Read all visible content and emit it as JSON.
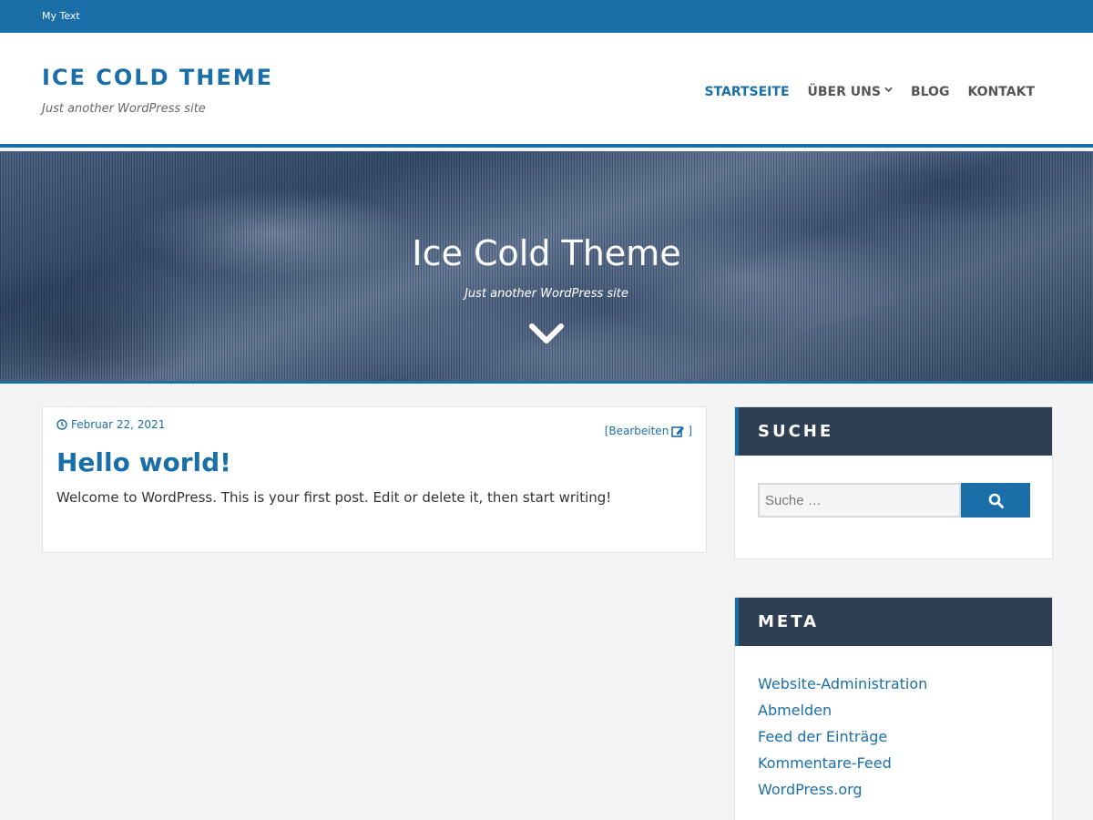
{
  "topbar": {
    "text": "My Text"
  },
  "header": {
    "site_title": "ICE COLD THEME",
    "tagline": "Just another WordPress site"
  },
  "nav": {
    "items": [
      {
        "label": "STARTSEITE",
        "active": true
      },
      {
        "label": "ÜBER UNS",
        "has_dropdown": true
      },
      {
        "label": "BLOG"
      },
      {
        "label": "KONTAKT"
      }
    ]
  },
  "hero": {
    "title": "Ice Cold Theme",
    "tagline": "Just another WordPress site",
    "arrow_icon": "chevron-down-icon"
  },
  "post": {
    "date": "Februar 22, 2021",
    "edit_label": "[Bearbeiten",
    "edit_close": "]",
    "title": "Hello world!",
    "excerpt": "Welcome to WordPress. This is your first post. Edit or delete it, then start writing!"
  },
  "sidebar": {
    "search": {
      "title": "SUCHE",
      "placeholder": "Suche …",
      "button_icon": "search-icon"
    },
    "meta": {
      "title": "META",
      "links": [
        "Website-Administration",
        "Abmelden",
        "Feed der Einträge",
        "Kommentare-Feed",
        "WordPress.org"
      ]
    }
  },
  "colors": {
    "primary": "#1b6fa8",
    "widget_header": "#2e3f54",
    "background": "#f4f4f4"
  }
}
